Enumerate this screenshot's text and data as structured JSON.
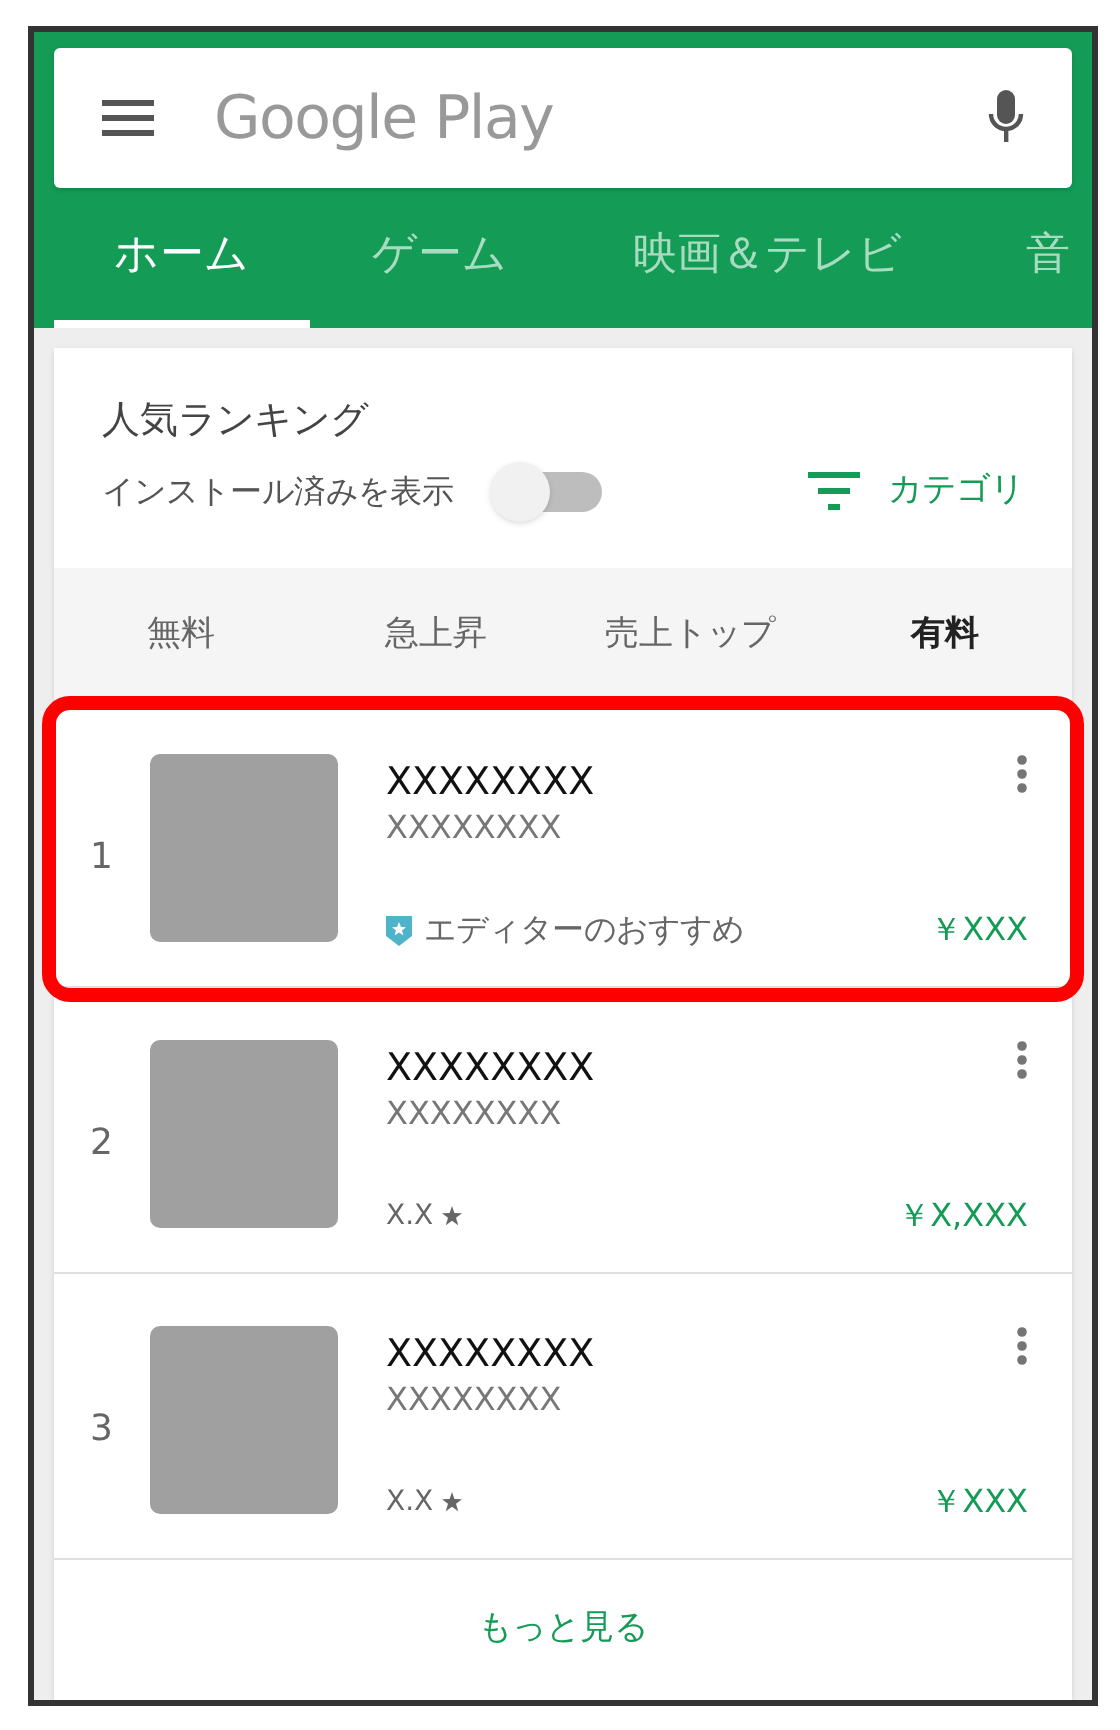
{
  "search": {
    "placeholder": "Google Play"
  },
  "tabs": [
    {
      "label": "ホーム",
      "selected": true
    },
    {
      "label": "ゲーム",
      "selected": false
    },
    {
      "label": "映画＆テレビ",
      "selected": false
    },
    {
      "label": "音",
      "selected": false
    }
  ],
  "ranking": {
    "title": "人気ランキング",
    "toggle": {
      "label": "インストール済みを表示",
      "on": false
    },
    "category": "カテゴリ",
    "subtabs": [
      {
        "label": "無料",
        "selected": false
      },
      {
        "label": "急上昇",
        "selected": false
      },
      {
        "label": "売上トップ",
        "selected": false
      },
      {
        "label": "有料",
        "selected": true
      }
    ],
    "items": [
      {
        "rank": "1",
        "title": "XXXXXXXX",
        "developer": "XXXXXXXX",
        "kind": "editors_choice",
        "badge": "エディターのおすすめ",
        "price": "￥XXX",
        "highlighted": true
      },
      {
        "rank": "2",
        "title": "XXXXXXXX",
        "developer": "XXXXXXXX",
        "kind": "rating",
        "rating": "X.X",
        "price": "￥X,XXX",
        "highlighted": false
      },
      {
        "rank": "3",
        "title": "XXXXXXXX",
        "developer": "XXXXXXXX",
        "kind": "rating",
        "rating": "X.X",
        "price": "￥XXX",
        "highlighted": false
      }
    ],
    "more": "もっと見る"
  }
}
